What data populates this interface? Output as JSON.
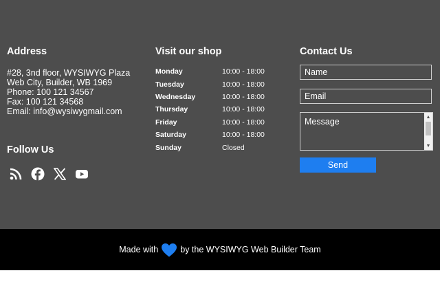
{
  "address": {
    "title": "Address",
    "lines": [
      "#28, 3nd floor, WYSIWYG Plaza",
      "Web City, Builder, WB 1969",
      "Phone: 100 121 34567",
      "Fax: 100 121 34568",
      "Email: info@wysiwygmail.com"
    ]
  },
  "follow": {
    "title": "Follow Us",
    "icons": [
      "rss-icon",
      "facebook-icon",
      "x-icon",
      "youtube-icon"
    ]
  },
  "shop": {
    "title": "Visit our shop",
    "hours": [
      {
        "day": "Monday",
        "time": "10:00 - 18:00"
      },
      {
        "day": "Tuesday",
        "time": "10:00 - 18:00"
      },
      {
        "day": "Wednesday",
        "time": "10:00 - 18:00"
      },
      {
        "day": "Thursday",
        "time": "10:00 - 18:00"
      },
      {
        "day": "Friday",
        "time": "10:00 - 18:00"
      },
      {
        "day": "Saturday",
        "time": "10:00 - 18:00"
      },
      {
        "day": "Sunday",
        "time": "Closed"
      }
    ]
  },
  "contact": {
    "title": "Contact Us",
    "name_placeholder": "Name",
    "email_placeholder": "Email",
    "message_placeholder": "Message",
    "send_label": "Send"
  },
  "credit": {
    "before": "Made with",
    "after": "by the WYSIWYG Web Builder Team",
    "heart_icon": "heart-icon"
  },
  "colors": {
    "footer_bg": "#4d4d4d",
    "bottom_bg": "#000000",
    "accent": "#1e7ef0"
  }
}
